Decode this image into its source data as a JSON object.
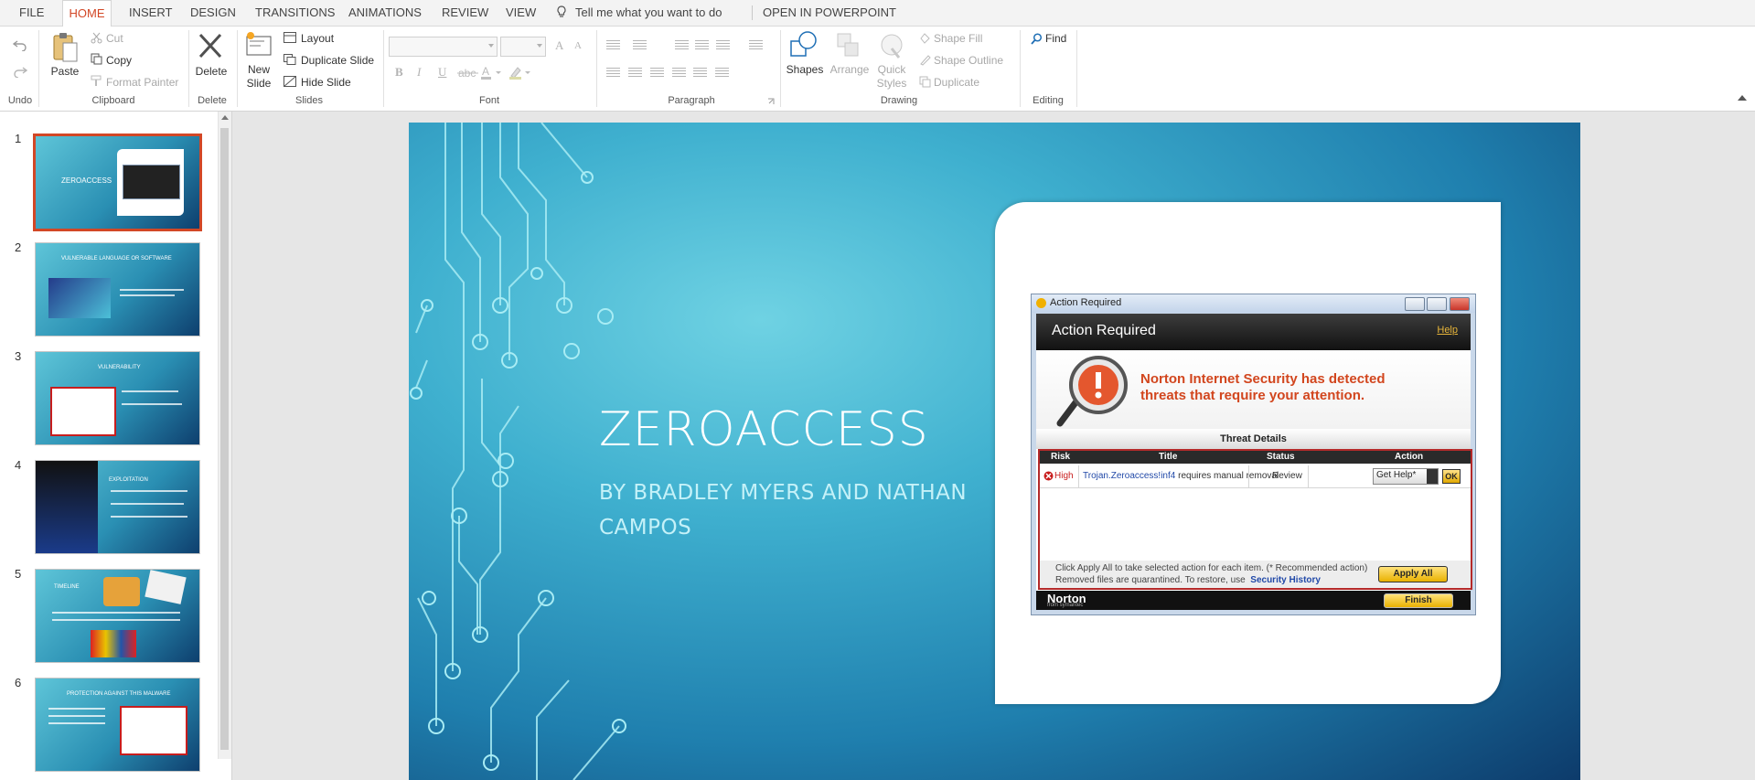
{
  "menu": {
    "tabs": [
      "FILE",
      "HOME",
      "INSERT",
      "DESIGN",
      "TRANSITIONS",
      "ANIMATIONS",
      "REVIEW",
      "VIEW"
    ],
    "active_tab": "HOME",
    "tell_me": "Tell me what you want to do",
    "open_in_app": "OPEN IN POWERPOINT"
  },
  "ribbon": {
    "undo_group": "Undo",
    "clipboard": {
      "paste": "Paste",
      "cut": "Cut",
      "copy": "Copy",
      "format_painter": "Format Painter",
      "group": "Clipboard"
    },
    "delete": {
      "label": "Delete",
      "group": "Delete"
    },
    "slides": {
      "new_slide_1": "New",
      "new_slide_2": "Slide",
      "layout": "Layout",
      "duplicate": "Duplicate Slide",
      "hide": "Hide Slide",
      "group": "Slides"
    },
    "font": {
      "group": "Font",
      "bold": "B",
      "italic": "I",
      "underline": "U",
      "grow": "A",
      "shrink": "A"
    },
    "paragraph": {
      "group": "Paragraph"
    },
    "drawing": {
      "shapes": "Shapes",
      "arrange": "Arrange",
      "quick_1": "Quick",
      "quick_2": "Styles",
      "shape_fill": "Shape Fill",
      "shape_outline": "Shape Outline",
      "duplicate": "Duplicate",
      "group": "Drawing"
    },
    "editing": {
      "find": "Find",
      "group": "Editing"
    }
  },
  "thumbnails": [
    {
      "num": "1",
      "title": "ZEROACCESS",
      "selected": true
    },
    {
      "num": "2",
      "title": "VULNERABLE LANGUAGE OR SOFTWARE",
      "selected": false
    },
    {
      "num": "3",
      "title": "VULNERABILITY",
      "selected": false
    },
    {
      "num": "4",
      "title": "EXPLOITATION",
      "selected": false
    },
    {
      "num": "5",
      "title": "TIMELINE",
      "selected": false
    },
    {
      "num": "6",
      "title": "PROTECTION AGAINST THIS MALWARE",
      "selected": false
    }
  ],
  "slide": {
    "title": "ZEROACCESS",
    "subtitle": "BY BRADLEY MYERS AND NATHAN CAMPOS",
    "dialog": {
      "window_title": "Action Required",
      "header": "Action Required",
      "help": "Help",
      "alert_line1": "Norton Internet Security has detected",
      "alert_line2": "threats that require your attention.",
      "threat_details": "Threat Details",
      "columns": [
        "Risk",
        "Title",
        "Status",
        "Action"
      ],
      "row": {
        "risk": "High",
        "title_link": "Trojan.Zeroaccess!inf4",
        "title_rest": " requires manual removal",
        "status": "Review",
        "action": "Get Help*",
        "ok": "OK"
      },
      "footer_line1": "Click Apply All to take selected action for each item. (* Recommended action)",
      "footer_line2": "Removed files are quarantined. To restore, use",
      "footer_link": "Security History",
      "apply_all": "Apply All",
      "brand": "Norton",
      "brand_sub": "from symantec",
      "finish": "Finish"
    }
  }
}
